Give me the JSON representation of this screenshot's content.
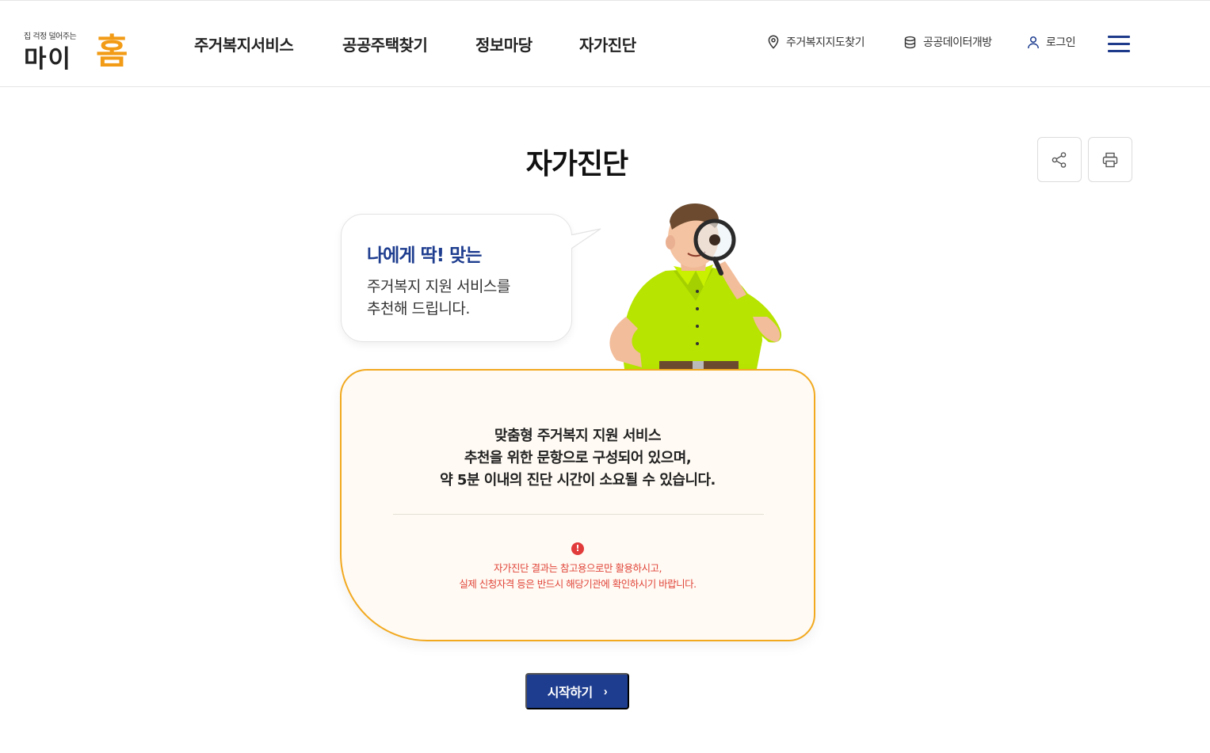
{
  "header": {
    "logo_tagline": "집 걱정 덜어주는",
    "logo_main": "마이",
    "logo_accent": "홈",
    "nav": [
      {
        "label": "주거복지서비스"
      },
      {
        "label": "공공주택찾기"
      },
      {
        "label": "정보마당"
      },
      {
        "label": "자가진단"
      }
    ],
    "utils": {
      "map": "주거복지지도찾기",
      "open_data": "공공데이터개방",
      "login": "로그인"
    }
  },
  "page": {
    "title": "자가진단"
  },
  "bubble": {
    "title": "나에게 딱! 맞는",
    "line1": "주거복지 지원 서비스를",
    "line2": "추천해 드립니다."
  },
  "card": {
    "line1": "맞춤형 주거복지 지원 서비스",
    "line2": "추천을 위한 문항으로 구성되어 있으며,",
    "line3": "약 5분 이내의 진단 시간이 소요될 수 있습니다.",
    "warn_icon": "!",
    "warn1": "자가진단 결과는 참고용으로만 활용하시고,",
    "warn2": "실제 신청자격 등은 반드시 해당기관에 확인하시기 바랍니다."
  },
  "start_button": {
    "label": "시작하기",
    "chevron": "›"
  },
  "colors": {
    "primary": "#1e3d8f",
    "accent": "#f29b16",
    "card_border": "#f2a91f",
    "warning": "#e0453a"
  },
  "icons": [
    "location-pin-icon",
    "database-icon",
    "user-icon",
    "hamburger-menu-icon",
    "share-icon",
    "print-icon",
    "warning-icon",
    "chevron-right-icon"
  ]
}
